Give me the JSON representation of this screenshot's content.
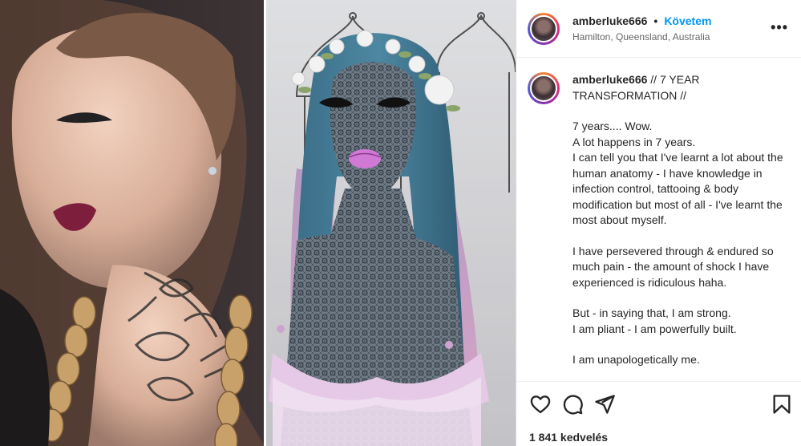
{
  "post": {
    "username": "amberluke666",
    "follow_label": "Követem",
    "separator": "•",
    "location": "Hamilton, Queensland, Australia",
    "more_label": "•••"
  },
  "caption": {
    "username": "amberluke666",
    "title": "// 7 YEAR TRANSFORMATION //",
    "lines": [
      "7 years.... Wow.",
      "A lot happens in 7 years.",
      "I can tell you that I've learnt a lot about the human anatomy - I have knowledge in infection control, tattooing & body modification but most of all - I've learnt the most about myself.",
      "",
      "I have persevered through & endured so much pain - the amount of shock I have experienced is ridiculous haha.",
      "",
      "But - in saying that, I am strong.",
      "I am pliant - I am powerfully built.",
      "",
      "I am unapologetically me."
    ]
  },
  "actions": {
    "like_icon": "heart-icon",
    "comment_icon": "comment-icon",
    "share_icon": "send-icon",
    "save_icon": "bookmark-icon"
  },
  "likes_text": "1 841 kedvelés",
  "colors": {
    "accent": "#0095f6",
    "text": "#262626",
    "muted": "#666666",
    "border": "#dbdbdb"
  }
}
